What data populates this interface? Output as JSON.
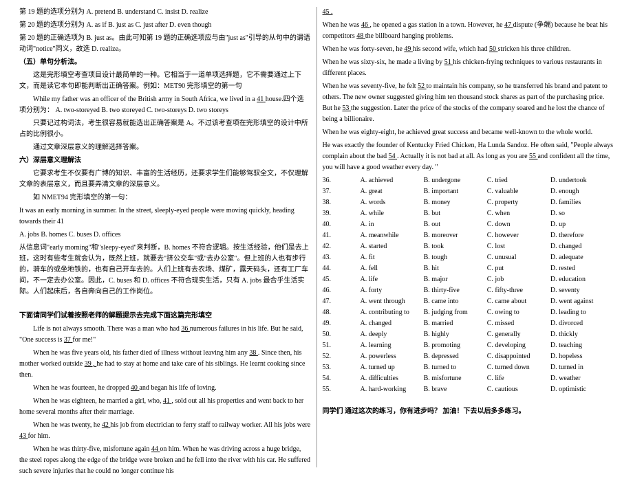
{
  "left": {
    "l1": "第 19 题的选项分别为 A. pretend    B. understand    C. insist    D. realize",
    "l2": "第 20 题的选项分别为 A. as if    B. just as    C. just after    D. even though",
    "l3": "第 20 题的正确选项为 B. just as。由此可知第 19 题的正确选项应与由\"just as\"引导的从句中的谓语动词\"notice\"同义，故选 D. realize。",
    "h5": "（五）单句分析法。",
    "p5a": "这是完形填空考查项目设计最简单的一种。它相当于一道单项选择题，它不需要通过上下文，而是读它本句即能判断出正确答案。例如：MET90 完形填空的第一句",
    "p5b_a": "While my father was an officer of the British army in South Africa, we lived in a ",
    "p5b_n": "41",
    "p5b_c": " house.四个选项分别为：  A. two-storeyed    B. two storeyed    C. two-storeys    D. two storeys",
    "p5c": "只要记过构词法，考生很容易就能选出正确答案是 A。不过该考查项在完形填空的设计中所占的比例很小。",
    "p5d": "通过文章深层意义的理解选择答案。",
    "h6": "六）深层意义理解法",
    "p6a": "它要求考生不仅要有广博的知识、丰富的生活经历，还要求学生们能够驾驭全文，不仅理解文章的表层意义，而且要弄清文章的深层意义。",
    "p6b": "如 NMET94 完形填空的第一句：",
    "p6c": "It was an early morning in summer. In the street, sleeply-eyed people were moving quickly, heading towards their    41",
    "p6d": "A. jobs    B. homes    C. buses    D. offices",
    "p6e": "从信息词\"early morning\"和\"sleepy-eyed\"来判断，B. homes 不符合逻辑。按生活经验，他们是去上班，这时有些考生就会认为，既然上班，就要去\"挤公交车\"或\"去办公室\"。但上班的人也有步行的，骑车的或坐地铁的，也有自己开车去的。人们上班有去农场、煤矿，露天码头，还有工厂车间，不一定去办公室。因此，C. buses 和 D. offices 不符合现实生活，只有 A. jobs 最合乎生活实际。人们起床后，各自奔向自己的工作岗位。",
    "h7": "下面请同学们试着按照老师的解题提示去完成下面这篇完形填空",
    "s1_a": "Life is not always smooth. There was a man who had ",
    "s1_n": "36",
    "s1_c": " numerous failures in his life. But he said, \"One success is ",
    "s1_n2": "37",
    "s1_d": " for me!\"",
    "s2_a": "When he was five years old, his father died of illness without leaving him any ",
    "s2_n": "38",
    "s2_b": " . Since then, his mother worked outside ",
    "s2_n2": "39 ,",
    "s2_c": " he had to stay at home and take care of his siblings. He learnt cooking since then.",
    "s3_a": "When he was fourteen, he dropped ",
    "s3_n": "40",
    "s3_b": " and began his life of loving.",
    "s4_a": "When he was eighteen, he married a girl, who, ",
    "s4_n": "41",
    "s4_b": " , sold out all his properties and went back to her home several months after their marriage.",
    "s5_a": "When he was twenty, he ",
    "s5_n": "42",
    "s5_b": " his job from electrician to ferry staff to railway worker. All his jobs were ",
    "s5_n2": "43",
    "s5_c": " for him.",
    "s6_a": "When he was thirty-five, misfortune again ",
    "s6_n": "44",
    "s6_b": " on him. When he was driving across a huge bridge, the steel ropes along the edge of the bridge were broken and he fell into the river with his car. He suffered such severe injuries that he could no longer continue his"
  },
  "right": {
    "r0": "45    .",
    "r1_a": "When he was ",
    "r1_n": "46",
    "r1_b": " , he opened a gas station in a town. However, he ",
    "r1_n2": "47",
    "r1_c": " dispute (争端) because he beat his competitors ",
    "r1_n3": "48",
    "r1_d": " the billboard hanging problems.",
    "r2_a": "When he was forty-seven, he ",
    "r2_n": "49",
    "r2_b": " his second wife, which had ",
    "r2_n2": "50",
    "r2_c": " stricken his three children.",
    "r3_a": "When he was sixty-six, he made a living by ",
    "r3_n": "51",
    "r3_b": " his chicken-frying techniques to various restaurants in different places.",
    "r4_a": "When he was seventy-five, he felt ",
    "r4_n": "52",
    "r4_b": " to maintain his company, so he transferred his brand and patent to others. The new owner suggested giving him ten thousand stock shares as part of the purchasing price. But he ",
    "r4_n2": "53",
    "r4_c": " the suggestion. Later the price of the stocks of the company soared and he lost the chance of being a billionaire.",
    "r5": "When he was eighty-eight, he achieved great success and became well-known to the whole world.",
    "r6_a": "He was exactly the founder of Kentucky Fried Chicken, Ha Lunda Sandoz. He often said, \"People always complain about the bad ",
    "r6_n": "54",
    "r6_b": " . Actually it is not bad at all. As long as you are ",
    "r6_n2": "55",
    "r6_c": " and confident all the time, you will have a good weather every day. \"",
    "opts": [
      {
        "n": "36.",
        "a": "A. achieved",
        "b": "B. undergone",
        "c": "C. tried",
        "d": "D. undertook"
      },
      {
        "n": "37.",
        "a": "A. great",
        "b": "B. important",
        "c": "C. valuable",
        "d": "D. enough"
      },
      {
        "n": "38.",
        "a": "A. words",
        "b": "B. money",
        "c": "C. property",
        "d": "D. families"
      },
      {
        "n": "39.",
        "a": "A. while",
        "b": "B. but",
        "c": "C. when",
        "d": "D. so"
      },
      {
        "n": "40.",
        "a": "A. in",
        "b": "B. out",
        "c": "C. down",
        "d": "D. up"
      },
      {
        "n": "41.",
        "a": "A. meanwhile",
        "b": "B. moreover",
        "c": "C. however",
        "d": "D. therefore"
      },
      {
        "n": "42.",
        "a": "A. started",
        "b": "B. took",
        "c": "C. lost",
        "d": "D. changed"
      },
      {
        "n": "43.",
        "a": "A. fit",
        "b": "B. tough",
        "c": "C. unusual",
        "d": "D. adequate"
      },
      {
        "n": "44.",
        "a": "A. fell",
        "b": "B. hit",
        "c": "C. put",
        "d": "D. rested"
      },
      {
        "n": "45.",
        "a": "A. life",
        "b": "B. major",
        "c": "C. job",
        "d": "D. education"
      },
      {
        "n": "46.",
        "a": "A. forty",
        "b": "B. thirty-five",
        "c": "C. fifty-three",
        "d": "D. seventy"
      },
      {
        "n": "47.",
        "a": "A. went through",
        "b": "B. came into",
        "c": "C. came about",
        "d": "D. went against"
      },
      {
        "n": "48.",
        "a": "A. contributing to",
        "b": "B. judging from",
        "c": "C. owing to",
        "d": "D. leading to"
      },
      {
        "n": "49.",
        "a": "A. changed",
        "b": "B. married",
        "c": "C. missed",
        "d": "D. divorced"
      },
      {
        "n": "50.",
        "a": "A. deeply",
        "b": "B. highly",
        "c": "C. generally",
        "d": "D. thickly"
      },
      {
        "n": "51.",
        "a": "A. learning",
        "b": "B. promoting",
        "c": "C. developing",
        "d": "D. teaching"
      },
      {
        "n": "52.",
        "a": "A. powerless",
        "b": "B. depressed",
        "c": "C. disappointed",
        "d": "D. hopeless"
      },
      {
        "n": "53.",
        "a": "A. turned up",
        "b": "B. turned to",
        "c": "C. turned down",
        "d": "D. turned in"
      },
      {
        "n": "54.",
        "a": "A. difficulties",
        "b": "B. misfortune",
        "c": "C. life",
        "d": "D. weather"
      },
      {
        "n": "55.",
        "a": "A. hard-working",
        "b": "B. brave",
        "c": "C. cautious",
        "d": "D. optimistic"
      }
    ],
    "footer": "同学们 通过这次的练习，你有进步吗？ 加油！下去以后多多练习。"
  }
}
